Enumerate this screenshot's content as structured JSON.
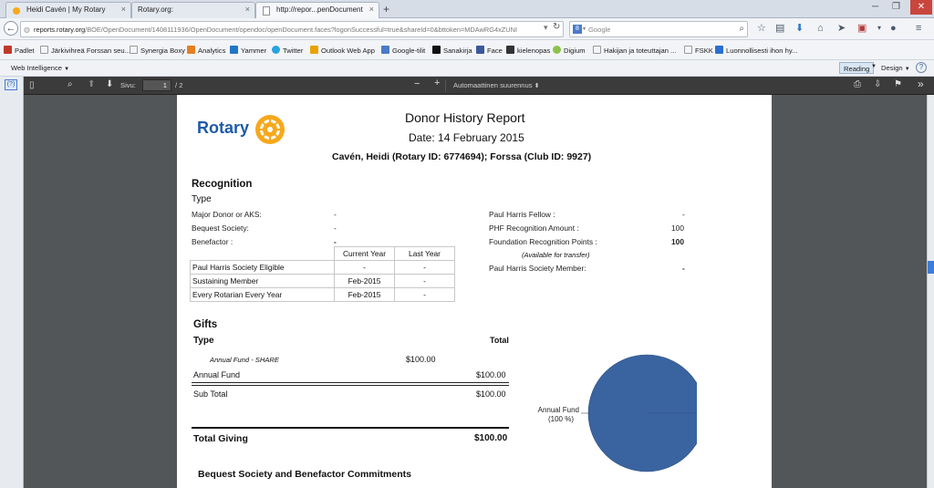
{
  "browser": {
    "tabs": [
      {
        "title": "Heidi Cavén | My Rotary",
        "active": false
      },
      {
        "title": "Rotary.org:",
        "active": false
      },
      {
        "title": "http://repor...penDocument",
        "active": true
      }
    ],
    "new_tab": "+",
    "url_domain": "reports.rotary.org",
    "url_rest": "/BOE/OpenDocument/1408111936/OpenDocument/opendoc/openDocument.faces?logonSuccessful=true&shareId=0&bttoken=MDAwRG4xZUNI",
    "search_placeholder": "Google",
    "search_engine_badge": "8",
    "bookmarks": [
      {
        "label": "Padlet",
        "color": "#c0392b"
      },
      {
        "label": "Järkivihreä Forssan seu...",
        "color": "#ffffff"
      },
      {
        "label": "Synergia Boxy",
        "color": "#ffffff"
      },
      {
        "label": "Analytics",
        "color": "#e67e22"
      },
      {
        "label": "Yammer",
        "color": "#1f77c8"
      },
      {
        "label": "Twitter",
        "color": "#2aa3e0"
      },
      {
        "label": "Outlook Web App",
        "color": "#e8a300"
      },
      {
        "label": "Google-tilit",
        "color": "#4a7ac8"
      },
      {
        "label": "Sanakirja",
        "color": "#111111"
      },
      {
        "label": "Face",
        "color": "#3b5998"
      },
      {
        "label": "kielenopas",
        "color": "#333333"
      },
      {
        "label": "Digium",
        "color": "#8bc34a"
      },
      {
        "label": "Hakijan ja toteuttajan ...",
        "color": "#ffffff"
      },
      {
        "label": "FSKK",
        "color": "#ffffff"
      },
      {
        "label": "Luonnollisesti ihon hy...",
        "color": "#2a6fd0"
      }
    ]
  },
  "webi": {
    "menu_label": "Web Intelligence",
    "reading": "Reading",
    "design": "Design",
    "help": "?"
  },
  "pdf_toolbar": {
    "page_label": "Sivu:",
    "page_current": "1",
    "page_total": "/ 2",
    "zoom_label": "Automaattinen suurennus",
    "zoom_out": "−",
    "zoom_in": "+"
  },
  "report": {
    "logo_text": "Rotary",
    "title": "Donor History Report",
    "date": "Date: 14 February 2015",
    "member_line": "Cavén,  Heidi  (Rotary ID: 6774694); Forssa (Club ID: 9927)",
    "recognition": {
      "heading": "Recognition",
      "type_label": "Type",
      "left_rows": [
        {
          "label": "Major Donor or AKS:",
          "value": "-"
        },
        {
          "label": "Bequest Society:",
          "value": "-"
        },
        {
          "label": "Benefactor :",
          "value": "-"
        }
      ],
      "right_rows": [
        {
          "label": "Paul Harris Fellow :",
          "value": "-"
        },
        {
          "label": "PHF Recognition Amount :",
          "value": "100"
        },
        {
          "label": "Foundation Recognition Points :",
          "value": "100"
        }
      ],
      "available_note": "(Available for transfer)",
      "phs_member_label": "Paul Harris Society Member:",
      "phs_member_value": "-",
      "table_headers": [
        "Current Year",
        "Last Year"
      ],
      "table_rows": [
        {
          "label": "Paul Harris Society Eligible",
          "current": "-",
          "last": "-"
        },
        {
          "label": "Sustaining Member",
          "current": "Feb-2015",
          "last": "-"
        },
        {
          "label": "Every Rotarian Every Year",
          "current": "Feb-2015",
          "last": "-"
        }
      ]
    },
    "gifts": {
      "heading": "Gifts",
      "type_label": "Type",
      "total_label": "Total",
      "line_item_label": "Annual Fund - SHARE",
      "line_item_amount": "$100.00",
      "annual_fund_label": "Annual Fund",
      "annual_fund_total": "$100.00",
      "subtotal_label": "Sub Total",
      "subtotal_value": "$100.00",
      "total_giving_label": "Total Giving",
      "total_giving_value": "$100.00"
    },
    "bequest_heading": "Bequest Society and Benefactor Commitments"
  },
  "chart_data": {
    "type": "pie",
    "categories": [
      "Annual Fund"
    ],
    "values": [
      100
    ],
    "slice_labels": [
      "Annual Fund",
      "(100 %)"
    ],
    "colors": [
      "#3a64a0"
    ]
  }
}
